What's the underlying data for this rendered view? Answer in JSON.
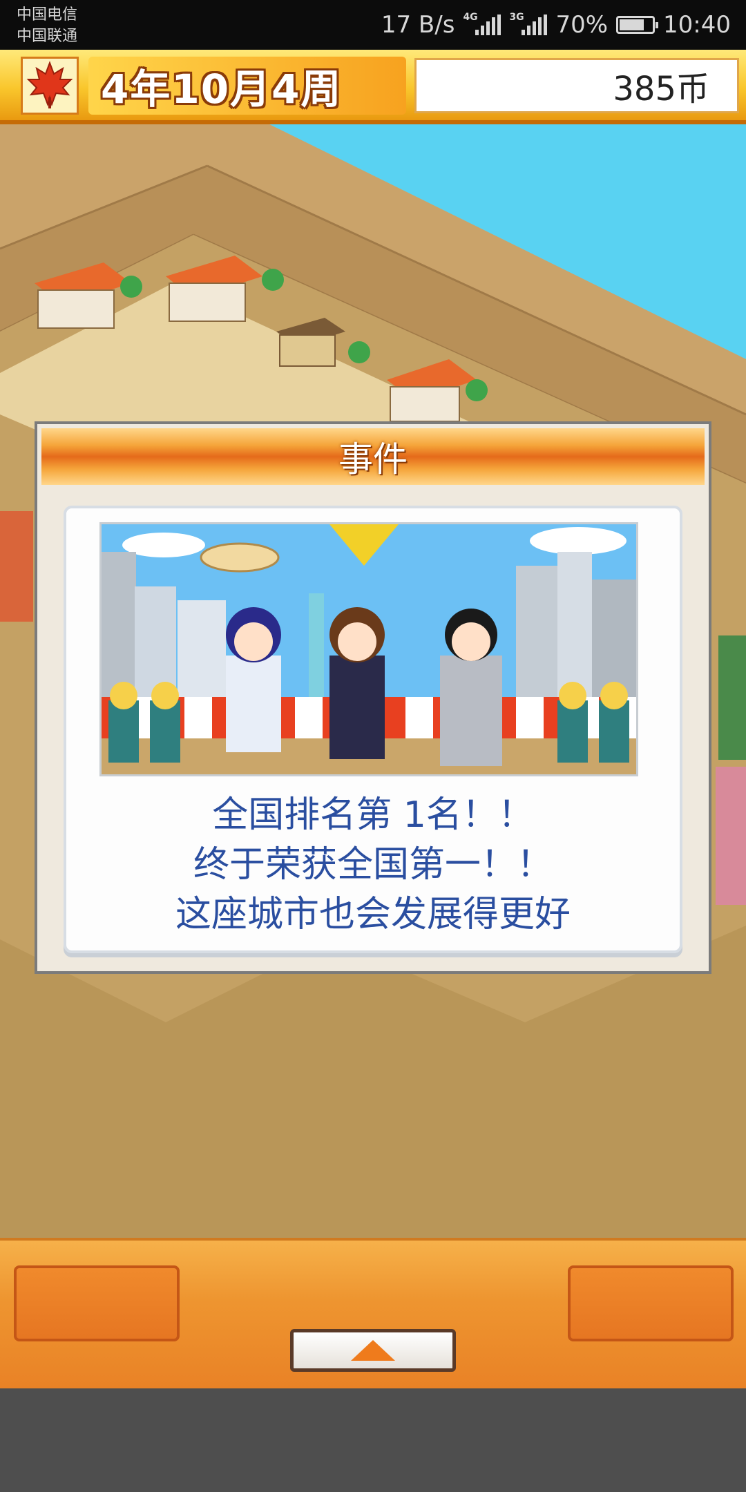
{
  "status_bar": {
    "carrier_1": "中国电信",
    "carrier_2": "中国联通",
    "net_speed": "17 B/s",
    "signal_1_tag": "4G",
    "signal_2_tag": "3G",
    "battery": "70%",
    "time": "10:40",
    "icons": [
      "signal-4g-icon",
      "signal-3g-icon",
      "battery-charging-icon"
    ]
  },
  "top_bar": {
    "season_icon": "maple-leaf-icon",
    "date": "4年10月4周",
    "money": "385币",
    "colors": {
      "bar": "#f9c62c",
      "date_text_outline": "#8a3b08"
    }
  },
  "event_dialog": {
    "title": "事件",
    "lines": [
      "全国排名第 1名！！",
      "终于荣获全国第一！！",
      "这座城市也会发展得更好"
    ],
    "colors": {
      "header": "#e56a1a",
      "text": "#2a4ea0"
    }
  },
  "bottom_panel": {
    "expand_icon": "up-arrow-icon",
    "colors": {
      "panel": "#ee9530",
      "arrow": "#ef7b1c"
    }
  }
}
